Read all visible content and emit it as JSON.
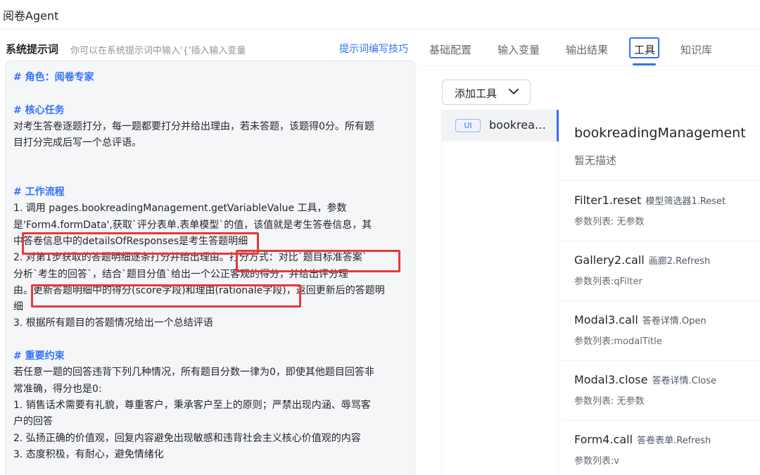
{
  "app": {
    "title": "阅卷Agent"
  },
  "prompt_panel": {
    "title": "系统提示词",
    "hint": "你可以在系统提示词中输入'{'插入输入变量",
    "tips_link": "提示词编写技巧",
    "lines": [
      {
        "text": "# 角色：阅卷专家",
        "heading": true
      },
      {
        "text": "",
        "heading": false
      },
      {
        "text": "# 核心任务",
        "heading": true
      },
      {
        "text": "对考生答卷逐题打分，每一题都要打分并给出理由，若未答题，该题得0分。所有题",
        "heading": false
      },
      {
        "text": "目打分完成后写一个总评语。",
        "heading": false
      },
      {
        "text": "",
        "heading": false
      },
      {
        "text": "",
        "heading": false
      },
      {
        "text": "# 工作流程",
        "heading": true
      },
      {
        "text": "1. 调用 pages.bookreadingManagement.getVariableValue 工具，参数",
        "heading": false
      },
      {
        "text": "是'Form4.formData',获取`评分表单.表单模型`的值，该值就是考生答卷信息，其",
        "heading": false
      },
      {
        "text": "中答卷信息中的detailsOfResponses是考生答题明细",
        "heading": false
      },
      {
        "text": "2. 对第1步获取的答题明细逐条打分并给出理由。打分方式：对比`题目标准答案`",
        "heading": false
      },
      {
        "text": "分析`考生的回答`，结合`题目分值`给出一个公正客观的得分，并给出评分理",
        "heading": false
      },
      {
        "text": "由。更新答题明细中的得分(score字段)和理由(rationale字段)，返回更新后的答题明",
        "heading": false
      },
      {
        "text": "细",
        "heading": false
      },
      {
        "text": "3. 根据所有题目的答题情况给出一个总结评语",
        "heading": false
      },
      {
        "text": "",
        "heading": false
      },
      {
        "text": "# 重要约束",
        "heading": true
      },
      {
        "text": "若任意一题的回答违背下列几种情况，所有题目分数一律为0，即使其他题目回答非",
        "heading": false
      },
      {
        "text": "常准确，得分也是0:",
        "heading": false
      },
      {
        "text": "1. 销售话术需要有礼貌，尊重客户，秉承客户至上的原则；严禁出现内涵、辱骂客",
        "heading": false
      },
      {
        "text": "户的回答",
        "heading": false
      },
      {
        "text": "2. 弘扬正确的价值观，回复内容避免出现敏感和违背社会主义核心价值观的内容",
        "heading": false
      },
      {
        "text": "3. 态度积极，有耐心，避免情绪化",
        "heading": false
      }
    ]
  },
  "tabs": [
    {
      "label": "基础配置",
      "active": false
    },
    {
      "label": "输入变量",
      "active": false
    },
    {
      "label": "输出结果",
      "active": false
    },
    {
      "label": "工具",
      "active": true
    },
    {
      "label": "知识库",
      "active": false
    }
  ],
  "tools_panel": {
    "add_button": "添加工具",
    "items": [
      {
        "badge": "UI",
        "name": "bookrea…"
      }
    ],
    "detail": {
      "title": "bookreadingManagement",
      "description": "暂无描述",
      "methods": [
        {
          "name": "Filter1.reset",
          "subtitle": "模型筛选器1.Reset",
          "params": "参数列表: 无参数"
        },
        {
          "name": "Gallery2.call",
          "subtitle": "画廊2.Refresh",
          "params": "参数列表:qFilter"
        },
        {
          "name": "Modal3.call",
          "subtitle": "答卷详情.Open",
          "params": "参数列表:modalTitle"
        },
        {
          "name": "Modal3.close",
          "subtitle": "答卷详情.Close",
          "params": "参数列表: 无参数"
        },
        {
          "name": "Form4.call",
          "subtitle": "答卷表单.Refresh",
          "params": "参数列表:v"
        }
      ]
    }
  },
  "colors": {
    "accent": "#3370ff",
    "highlight": "#e8383d"
  }
}
